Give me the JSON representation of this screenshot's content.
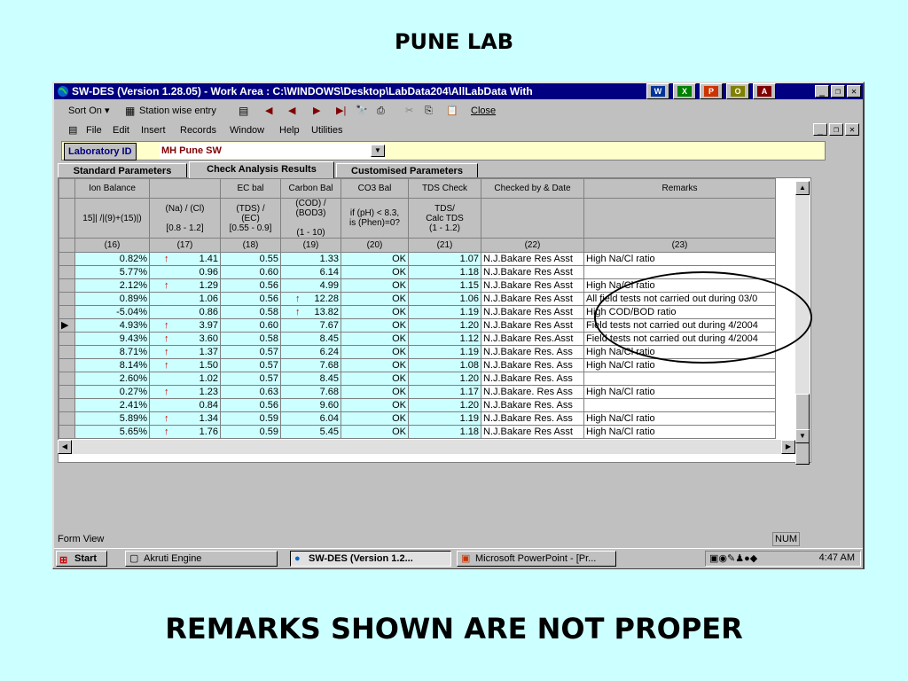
{
  "slide": {
    "title": "PUNE LAB",
    "caption": "REMARKS SHOWN ARE NOT PROPER"
  },
  "window": {
    "title": "SW-DES (Version 1.28.05) - Work Area : C:\\WINDOWS\\Desktop\\LabData204\\AllLabData With",
    "title_color": "#000080"
  },
  "toolbar": {
    "sort_on": "Sort On ▾",
    "station_wise": "Station wise entry",
    "close": "Close"
  },
  "menu": [
    "File",
    "Edit",
    "Insert",
    "Records",
    "Window",
    "Help",
    "Utilities"
  ],
  "lab_id": {
    "label": "Laboratory ID",
    "value": "MH Pune SW"
  },
  "tabs": [
    "Standard Parameters",
    "Check Analysis Results",
    "Customised Parameters"
  ],
  "grid": {
    "header_row1": [
      "Ion Balance",
      "",
      "EC bal",
      "Carbon Bal",
      "CO3 Bal",
      "TDS Check",
      "Checked by & Date",
      "Remarks"
    ],
    "header_row2": [
      "15]| /|(9)+(15)|)",
      "(Na) / (Cl)\n\n[0.8 - 1.2]",
      "(TDS) /\n(EC)\n[0.55 - 0.9]",
      "(COD) / (BOD3)\n\n(1 - 10)",
      "if (pH) < 8.3,\nis (Phen)=0?",
      "TDS/\nCalc TDS\n(1 - 1.2)",
      "",
      ""
    ],
    "header_row3": [
      "(16)",
      "(17)",
      "(18)",
      "(19)",
      "(20)",
      "(21)",
      "(22)",
      "(23)"
    ],
    "rows": [
      [
        "0.82%",
        "1.41",
        "0.55",
        "1.33",
        "OK",
        "1.07",
        "N.J.Bakare Res Asst",
        "High Na/Cl ratio"
      ],
      [
        "5.77%",
        "0.96",
        "0.60",
        "6.14",
        "OK",
        "1.18",
        "N.J.Bakare Res Asst",
        ""
      ],
      [
        "2.12%",
        "1.29",
        "0.56",
        "4.99",
        "OK",
        "1.15",
        "N.J.Bakare Res Asst",
        "High Na/Cl ratio"
      ],
      [
        "0.89%",
        "1.06",
        "0.56",
        "12.28",
        "OK",
        "1.06",
        "N.J.Bakare Res Asst",
        "All field tests not carried out during 03/0"
      ],
      [
        "-5.04%",
        "0.86",
        "0.58",
        "13.82",
        "OK",
        "1.19",
        "N.J.Bakare Res Asst",
        "High COD/BOD ratio"
      ],
      [
        "4.93%",
        "3.97",
        "0.60",
        "7.67",
        "OK",
        "1.20",
        "N.J.Bakare Res Asst",
        "Field tests not carried out during 4/2004"
      ],
      [
        "9.43%",
        "3.60",
        "0.58",
        "8.45",
        "OK",
        "1.12",
        "N.J.Bakare Res.Asst",
        "Field tests not carried out during 4/2004"
      ],
      [
        "8.71%",
        "1.37",
        "0.57",
        "6.24",
        "OK",
        "1.19",
        "N.J.Bakare Res. Ass",
        "High Na/Cl ratio"
      ],
      [
        "8.14%",
        "1.50",
        "0.57",
        "7.68",
        "OK",
        "1.08",
        "N.J.Bakare Res. Ass",
        "High Na/Cl ratio"
      ],
      [
        "2.60%",
        "1.02",
        "0.57",
        "8.45",
        "OK",
        "1.20",
        "N.J.Bakare Res. Ass",
        ""
      ],
      [
        "0.27%",
        "1.23",
        "0.63",
        "7.68",
        "OK",
        "1.17",
        "N.J.Bakare. Res Ass",
        "High Na/Cl ratio"
      ],
      [
        "2.41%",
        "0.84",
        "0.56",
        "9.60",
        "OK",
        "1.20",
        "N.J.Bakare Res. Ass",
        ""
      ],
      [
        "5.89%",
        "1.34",
        "0.59",
        "6.04",
        "OK",
        "1.19",
        "N.J.Bakare Res. Ass",
        "High Na/Cl ratio"
      ],
      [
        "5.65%",
        "1.76",
        "0.59",
        "5.45",
        "OK",
        "1.18",
        "N.J.Bakare Res Asst",
        "High Na/Cl ratio"
      ]
    ],
    "na_cl_arrow_rows": [
      0,
      2,
      5,
      6,
      7,
      8,
      10,
      12,
      13
    ],
    "cod_arrow_rows": [
      3,
      4
    ],
    "selected_row": 5
  },
  "status": {
    "form_view": "Form View",
    "num": "NUM"
  },
  "taskbar": {
    "start": "Start",
    "items": [
      "Akruti Engine",
      "SW-DES (Version 1.2...",
      "Microsoft PowerPoint - [Pr..."
    ],
    "clock": "4:47 AM"
  },
  "colors": {
    "teal_bg": "#ccffff",
    "cell_bg": "#ccffff",
    "arrow": "#cc0000"
  }
}
